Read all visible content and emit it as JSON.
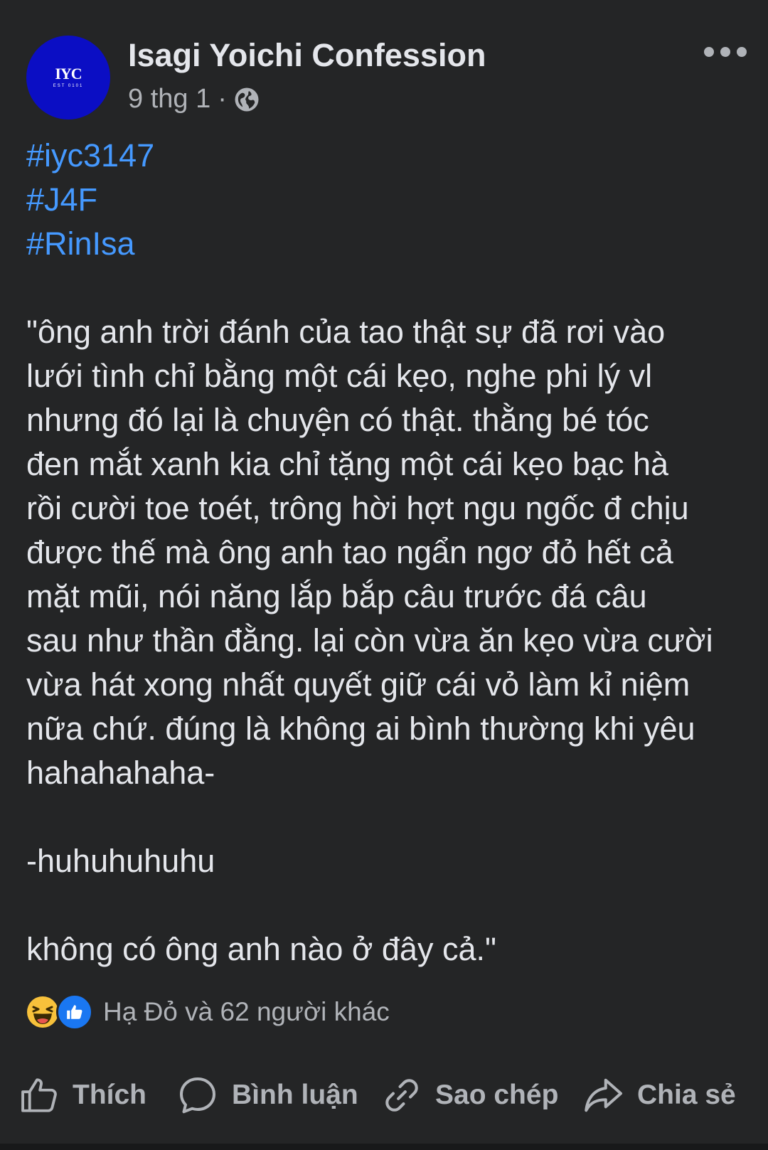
{
  "header": {
    "avatar_text": "IYC",
    "avatar_subtext": "EST 0101",
    "page_name": "Isagi Yoichi Confession",
    "date": "9 thg 1",
    "dot": "·",
    "privacy_icon": "globe-icon",
    "more_icon": "more-horizontal-icon"
  },
  "post": {
    "hashtags": [
      "#iyc3147",
      "#J4F",
      "#RinIsa"
    ],
    "lines": [
      "\"ông anh trời đánh của tao thật sự đã rơi vào",
      "lưới tình chỉ bằng một cái kẹo, nghe phi lý vl",
      "nhưng đó lại là chuyện có thật. thằng bé tóc",
      "đen mắt xanh kia chỉ tặng một cái kẹo bạc hà",
      "rồi cười toe toét, trông hời hợt ngu ngốc đ chịu",
      "được thế mà ông anh tao ngẩn ngơ đỏ hết cả",
      "mặt mũi, nói năng lắp bắp câu trước đá câu",
      "sau như thần đằng. lại còn vừa ăn kẹo vừa cười",
      "vừa hát xong nhất quyết giữ cái vỏ làm kỉ niệm",
      "nữa chứ. đúng là không ai bình thường khi yêu",
      "hahahahaha-"
    ],
    "line2": "-huhuhuhuhu",
    "line3": "không có ông anh nào ở đây cả.\""
  },
  "reactions": {
    "icons": [
      "haha-reaction-icon",
      "like-reaction-icon"
    ],
    "summary": "Hạ Đỏ và 62 người khác"
  },
  "actions": {
    "like": "Thích",
    "comment": "Bình luận",
    "copy": "Sao chép",
    "share": "Chia sẻ"
  },
  "colors": {
    "background": "#242526",
    "hashtag": "#4599ff",
    "text": "#e4e6eb",
    "secondary": "#b0b3b8",
    "avatar": "#0b0ec4",
    "like_blue": "#1a77f2",
    "haha_yellow": "#f7c13b"
  }
}
